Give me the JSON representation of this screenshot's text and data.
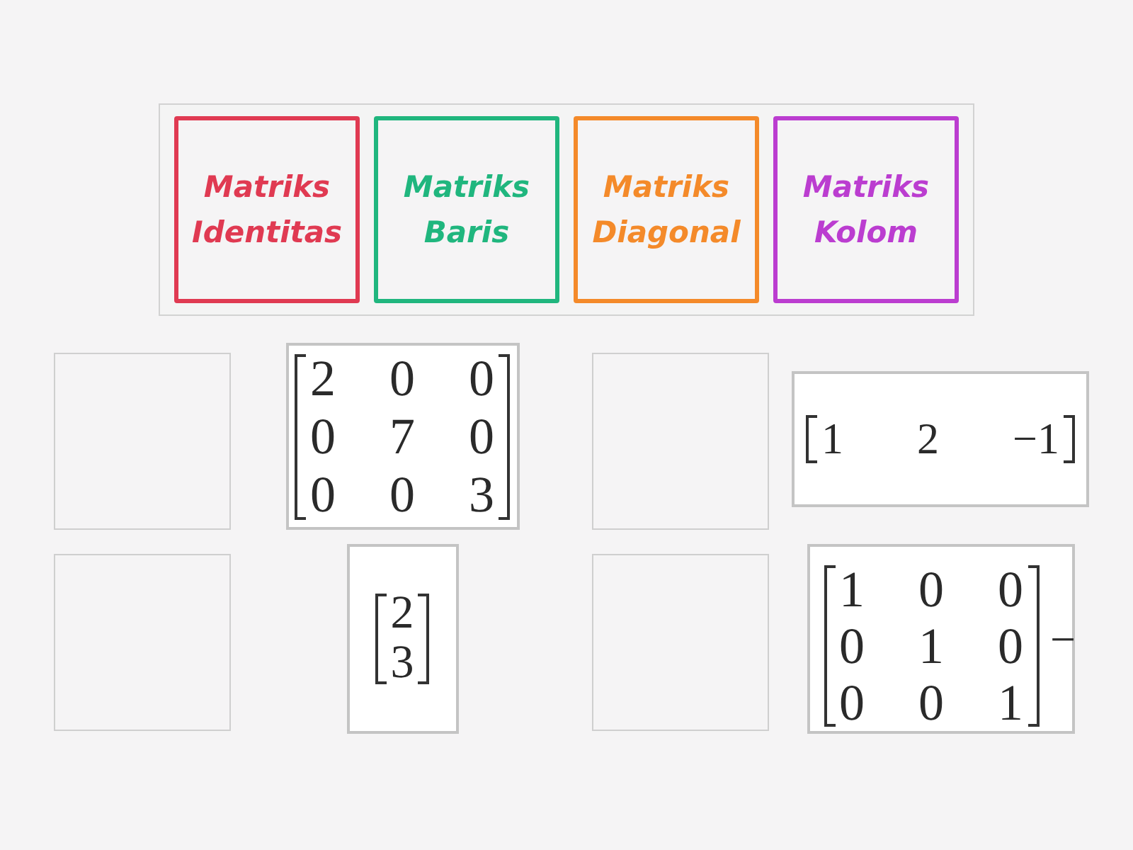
{
  "answer_tiles": [
    {
      "label": "Matriks Identitas",
      "color": "#e03a52"
    },
    {
      "label": "Matriks Baris",
      "color": "#20b67e"
    },
    {
      "label": "Matriks Diagonal",
      "color": "#f48a2a"
    },
    {
      "label": "Matriks Kolom",
      "color": "#bb3dd0"
    }
  ],
  "items": [
    {
      "matrix": [
        [
          "2",
          "0",
          "0"
        ],
        [
          "0",
          "7",
          "0"
        ],
        [
          "0",
          "0",
          "3"
        ]
      ]
    },
    {
      "matrix": [
        [
          "1",
          "2",
          "−1"
        ]
      ]
    },
    {
      "matrix": [
        [
          "2"
        ],
        [
          "3"
        ]
      ]
    },
    {
      "matrix": [
        [
          "1",
          "0",
          "0"
        ],
        [
          "0",
          "1",
          "0"
        ],
        [
          "0",
          "0",
          "1"
        ]
      ],
      "trailing": "−"
    }
  ]
}
